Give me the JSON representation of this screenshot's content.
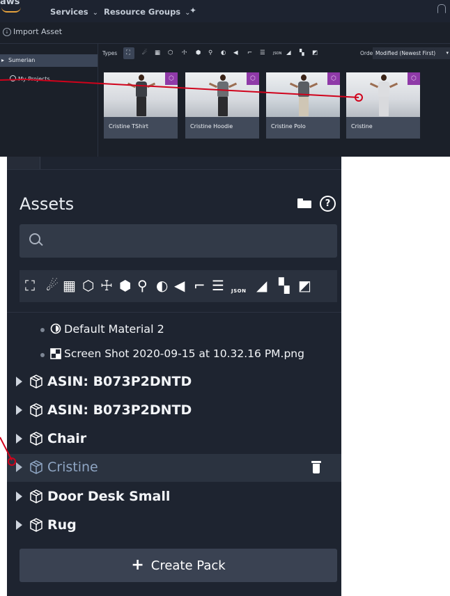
{
  "top_nav": {
    "logo": "aws",
    "services": "Services",
    "resource_groups": "Resource Groups",
    "pin_icon": "pin-icon",
    "bell_icon": "bell-icon"
  },
  "dialog": {
    "title": "Import Asset",
    "tree": {
      "root": "Sumerian",
      "projects": "My Projects"
    },
    "types_label": "Types",
    "order_label": "Order",
    "order_value": "Modified (Newest First)",
    "cards": [
      {
        "label": "Cristine TShirt"
      },
      {
        "label": "Cristine Hoodie"
      },
      {
        "label": "Cristine Polo"
      },
      {
        "label": "Cristine"
      }
    ]
  },
  "assets": {
    "title": "Assets",
    "search_placeholder": "",
    "type_icons": [
      "entity-icon",
      "light-icon",
      "video-icon",
      "mesh-icon",
      "skeleton-icon",
      "box-icon",
      "animation-icon",
      "material-icon",
      "sound-icon",
      "script-icon",
      "text-icon",
      "json-icon",
      "pose-icon",
      "texture-icon",
      "image-icon"
    ],
    "json_label": "JSON",
    "sub_items": [
      {
        "label": "Default Material 2"
      },
      {
        "label": "Screen Shot 2020-09-15 at 10.32.16 PM.png"
      }
    ],
    "packs": [
      {
        "label": "ASIN: B073P2DNTD"
      },
      {
        "label": "ASIN: B073P2DNTD"
      },
      {
        "label": "Chair"
      },
      {
        "label": "Cristine"
      },
      {
        "label": "Door Desk Small"
      },
      {
        "label": "Rug"
      }
    ],
    "create_pack": "Create Pack"
  },
  "colors": {
    "badge": "#8f3aa8",
    "callout": "#d0021b",
    "panel_bg": "#1e2430"
  }
}
